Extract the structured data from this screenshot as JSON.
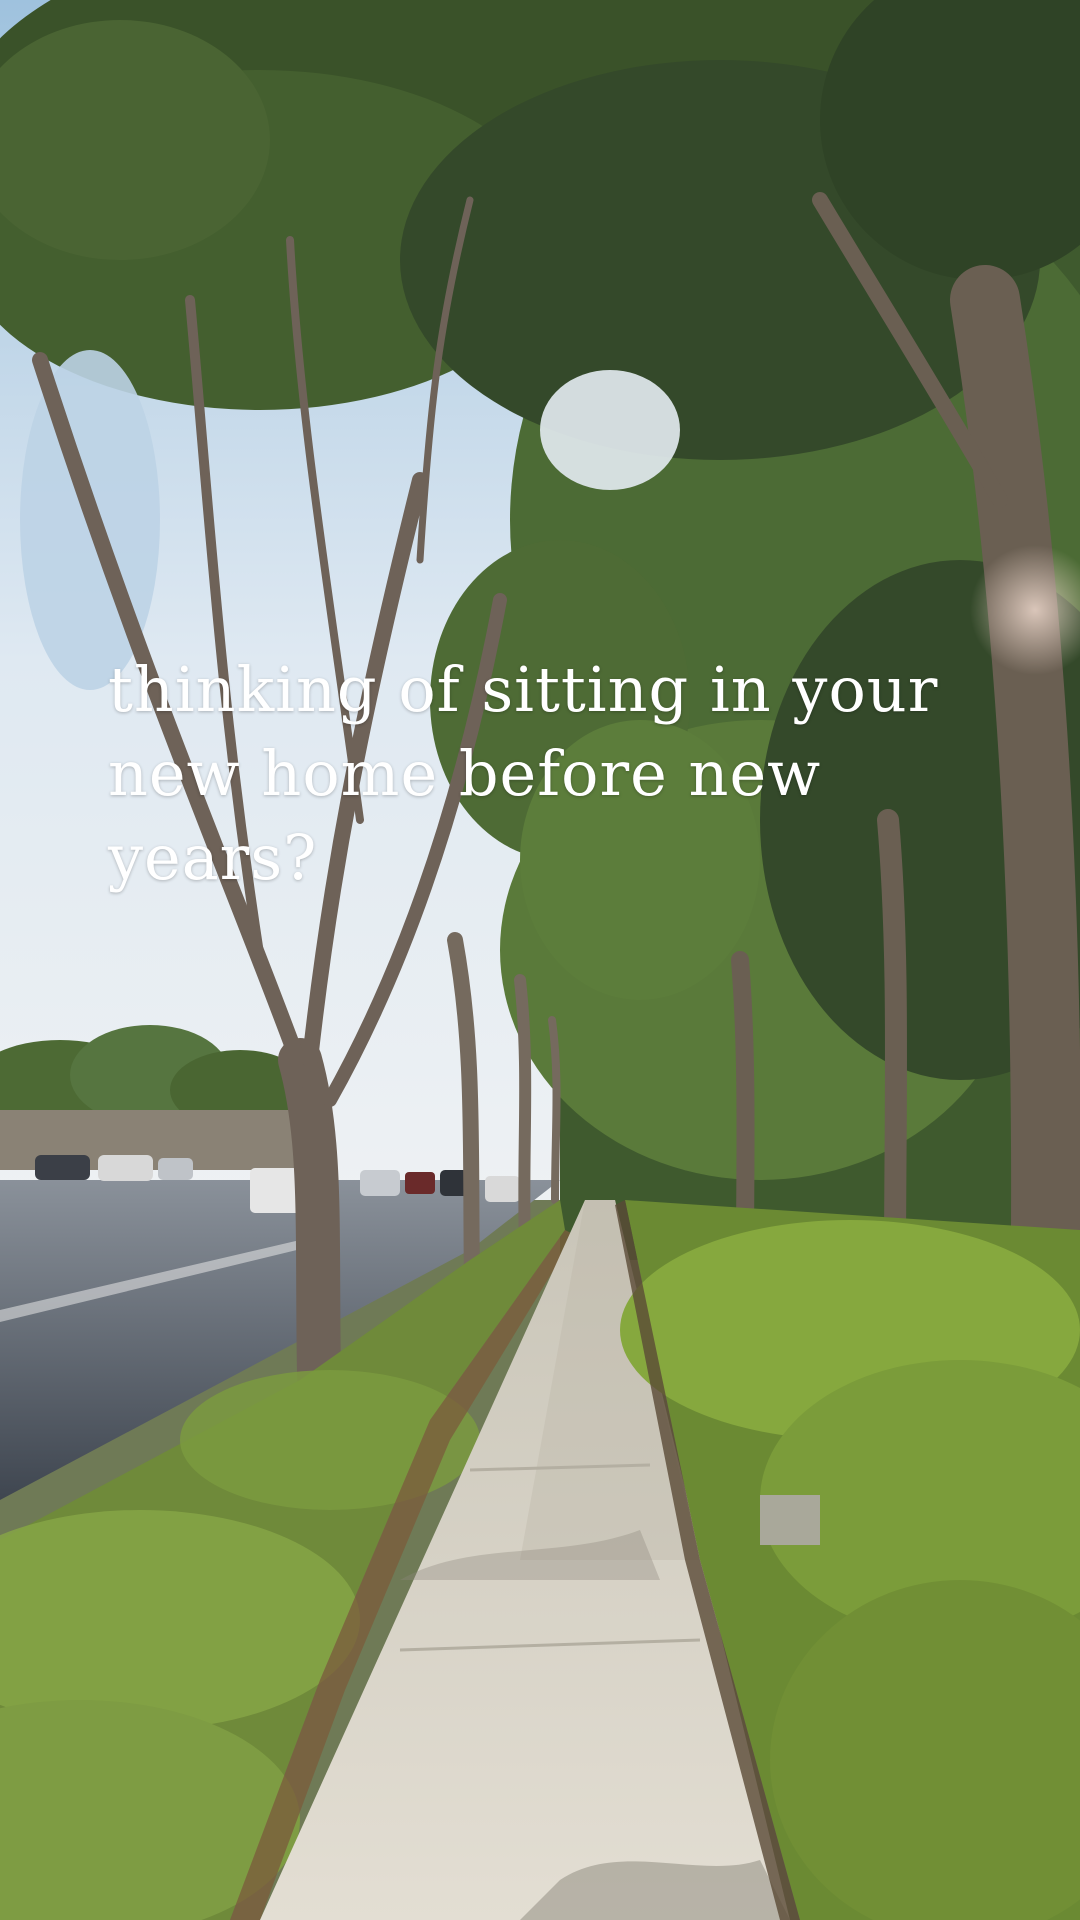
{
  "overlay": {
    "caption": "thinking of sitting in your new home before new years?"
  },
  "colors": {
    "sky": "#dfe9f2",
    "foliage": "#3f5a2e",
    "hedge": "#7f9a3c",
    "sidewalk": "#d9d4c8",
    "road": "#4e5660",
    "caption_text": "#ffffff"
  }
}
